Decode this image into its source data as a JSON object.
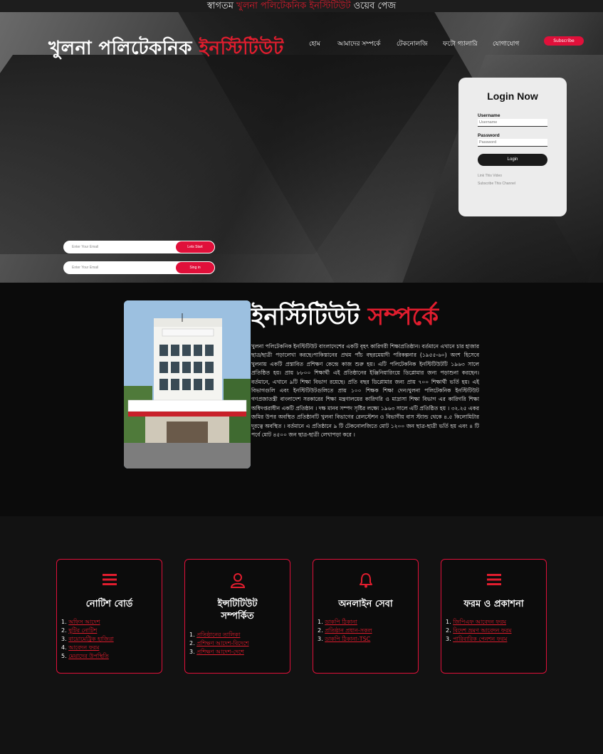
{
  "marquee": {
    "welcome": "স্বাগতম",
    "institute": "খুলনা পলিটেকনিক ইনস্টিটিউট",
    "webpage": "ওয়েব পেজ"
  },
  "logo": {
    "part1": "খুলনা পলিটেকনিক",
    "part2": "ইনস্টিটিউট"
  },
  "nav": {
    "items": [
      "হোম",
      "আমাদের সম্পর্কে",
      "টেকনোলজি",
      "ফটো গ্যালারি",
      "যোগাযোগ"
    ],
    "subscribe": "Subscribe"
  },
  "login": {
    "title": "Login Now",
    "username_label": "Username",
    "username_placeholder": "Username",
    "password_label": "Password",
    "password_placeholder": "Password",
    "button": "Login",
    "link1": "Link This Video",
    "link2": "Subscribe This Channel"
  },
  "email_forms": [
    {
      "placeholder": "Enter Your Email",
      "button": "Lets Start"
    },
    {
      "placeholder": "Enter Your Email",
      "button": "Sing in"
    }
  ],
  "about": {
    "title_white": "ইনস্টিটিউট",
    "title_red": "সম্পর্কে",
    "body": "খুলনা পলিটেকনিক ইনস্টিটিউট বাংলাদেশের একটি বৃহৎ কারিগরী শিক্ষাপ্রতিষ্ঠান। বর্তমানে এখানে চার হাজার ছাত্র/ছাত্রী পড়ালেখা করছে।পাকিস্তানের প্রথম পাঁচ বছরমেয়াদী পরিকল্পনার (১৯৫৫-৬০) অংশ হিসেবে খুলনায় একটি প্রস্তাবিত প্রশিক্ষণ কেন্দ্রে কাজ শুরু হয়। এটি পলিটেকনিক ইনস্টিটিউটটি ১৯৬৩ সালে প্রতিষ্ঠিত হয়। প্রায় ৮৮০০ শিক্ষার্থী এই প্রতিষ্ঠানের ইঞ্জিনিয়ারিংয়ে ডিপ্লোমার জন্য পড়াশুনা করছেন। বর্তমানে, এখানে ৯টি শিক্ষা বিভাগ রয়েছে। প্রতি বছর ডিপ্লোমার জন্য প্রায় ৭০০ শিক্ষার্থী ভর্তি হয়। এই বিভাগগুলি এবং ইনস্টিটিউটগুলিতে প্রায় ১০০ শিক্ষক শিক্ষা দেন।খুলনা পলিটেকনিক ইনস্টিটিউট গণপ্রজাতন্ত্রী বাংলাদেশ সরকারের শিক্ষা মন্ত্রণালয়ের কারিগরি ও মাদ্রাসা শিক্ষা বিভাগ এর কারিগরি শিক্ষা অধিদপ্তরাধীন একটি প্রতিষ্ঠান । দক্ষ মানব সম্পদ সৃষ্টির লক্ষ্যে ১৯৬৩ সালে এটি প্রতিষ্ঠিত হয় । ৩২.২৫ একর জমির উপর অবস্থিত প্রতিষ্ঠানটি খুলনা বিভাগের রেলস্টেশন ও বিভাগীয় বাস স্ট্যান্ড থেকে ৪.৫ কিলোমিটার দূরত্বে অবস্থিত । বর্তমানে এ প্রতিষ্ঠানে ৯ টি টেকনোলজিতে মোট ১২০০ জন ছাত্র-ছাত্রী ভর্তি হয় এবং ৪ টি পর্বে মোট ৪৫০০ জন ছাত্র-ছাত্রী লেখাপড়া করে ।",
    "photo_signboard": "খুলনা পলিটেকনিক ইনস্টিটিউট, খুলনা-৯২০৮ স্থাপিত-১৯৬৩ ইং"
  },
  "cards": [
    {
      "icon": "menu-icon",
      "title": [
        "নোটিশ বোর্ড"
      ],
      "items": [
        "অফিস আদেশ",
        "ছুটির নোটিশ",
        "বায়োমেট্রিক হাজিরা",
        "আবেদন ফরম",
        "মেয়াদের উপস্থিতি"
      ]
    },
    {
      "icon": "user-icon",
      "title": [
        "ইন্সটিটিউট",
        "সম্পর্কিত"
      ],
      "items": [
        "প্রতিষ্ঠানের তালিকা",
        "প্রশিক্ষণ আদেশ-বিদেশে",
        "প্রশিক্ষণ আদেশ-দেশে"
      ]
    },
    {
      "icon": "bell-icon",
      "title": [
        "অনলাইন সেবা"
      ],
      "items": [
        "ডাকপি ঠিকানা",
        "প্রতিষ্ঠান প্রধান-সকল",
        "ডাকপি ঠিকানা-TSC"
      ]
    },
    {
      "icon": "menu-icon",
      "title": [
        "ফরম ও প্রকাশনা"
      ],
      "items": [
        "জিপিএফ আবেদন ফরম",
        "বিদেশ ভ্রমণ আবেদন ফরম",
        "পারিবারিক পেনশন ফরম"
      ]
    }
  ],
  "colors": {
    "accent": "#e11d2e",
    "pink": "#e0103a",
    "dark": "#0b0b0b"
  }
}
